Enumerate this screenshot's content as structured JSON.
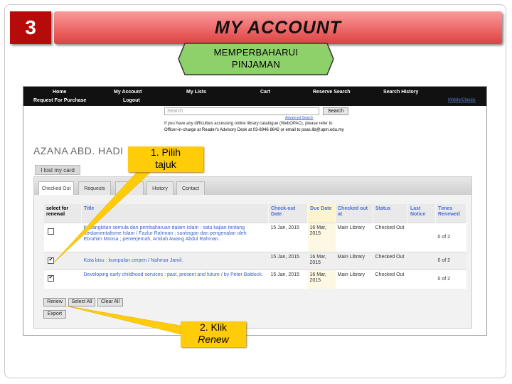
{
  "header": {
    "step_number": "3",
    "title": "MY ACCOUNT"
  },
  "subtitle": {
    "line1": "MEMPERBAHARUI",
    "line2": "PINJAMAN"
  },
  "nav": {
    "items": [
      "Home",
      "My Account",
      "My Lists",
      "Cart",
      "Reserve Search",
      "Search History"
    ],
    "row2": [
      "Request For Purchase",
      "Logout"
    ],
    "mobile": "Mobile/Classic"
  },
  "search": {
    "placeholder": "Search",
    "button": "Search",
    "advanced": "Advanced Search"
  },
  "notice": {
    "line1": "If you have any difficulties accessing online library catalogue (WebOPAC), please refer to",
    "line2": "Officer-in-charge at Reader's Advisory Desk at 03-8946 8642 or email to psas.lib@upm.edu.my"
  },
  "user": {
    "name": "AZANA ABD. HADI",
    "lost_card": "I lost my card"
  },
  "tabs": [
    "Checked Out",
    "Requests",
    "Ac",
    "History",
    "Contact"
  ],
  "table": {
    "headers": {
      "select": "select for renewal",
      "title": "Title",
      "checkout": "Check-out Date",
      "due": "Due Date",
      "checked_at": "Checked out at",
      "status": "Status",
      "last_notice": "Last Notice",
      "times": "Times Renewed"
    },
    "rows": [
      {
        "checked": false,
        "title": "Kebangkitan semula dan pembaharuan dalam Islam : satu kajian tentang fundamentalisme Islam / Fazlur Rahman ; suntingan dan pengenalan oleh Ebrahim Moosa ; penterjemah, Amilah Awang Abdul Rahman.",
        "checkout": "15 Jan, 2015",
        "due": "16 Mar, 2015",
        "location": "Main Library",
        "status": "Checked Out",
        "notice": "",
        "times": "0 of 2"
      },
      {
        "checked": true,
        "title": "Kota bisu : kumpulan cerpen / Nahmar Jamil.",
        "checkout": "15 Jan, 2015",
        "due": "16 Mar, 2015",
        "location": "Main Library",
        "status": "Checked Out",
        "notice": "",
        "times": "0 of 2"
      },
      {
        "checked": true,
        "title": "Developing early childhood services : past, present and future / by Peter Baldock.",
        "checkout": "15 Jan, 2015",
        "due": "16 Mar, 2015",
        "location": "Main Library",
        "status": "Checked Out",
        "notice": "",
        "times": "0 of 2"
      }
    ]
  },
  "actions": {
    "renew": "Renew",
    "select_all": "Select All",
    "clear_all": "Clear All",
    "export": "Export"
  },
  "callouts": {
    "c1_line1": "1. Pilih",
    "c1_line2": "tajuk",
    "c2_line1": "2. Klik",
    "c2_line2": "Renew"
  },
  "colors": {
    "title_bar": "#e85b5b",
    "step_box": "#b50b0b",
    "subtitle_fill": "#8ed16a",
    "callout": "#ffcc0a",
    "navbar": "#111111"
  }
}
